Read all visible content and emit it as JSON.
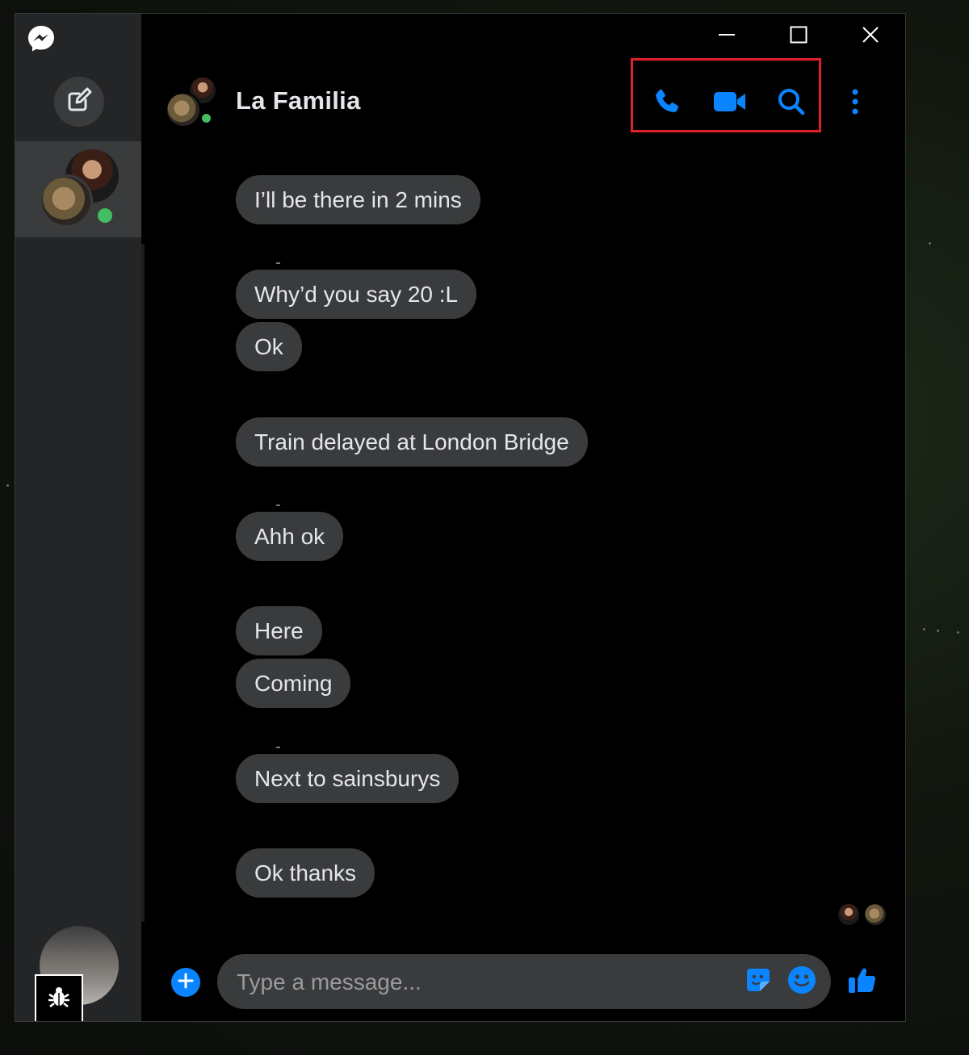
{
  "window": {
    "minimize_icon": "minimize-icon",
    "maximize_icon": "maximize-icon",
    "close_icon": "close-icon"
  },
  "sidebar": {
    "logo_icon": "messenger-logo-icon",
    "compose_icon": "compose-icon",
    "bug_icon": "bug-icon"
  },
  "header": {
    "title": "La Familia",
    "call_icon": "phone-icon",
    "video_icon": "video-camera-icon",
    "search_icon": "search-icon",
    "more_icon": "more-vertical-icon"
  },
  "messages": [
    {
      "text": "I’ll be there in 2 mins"
    },
    {
      "text": "Why’d you say 20 :L"
    },
    {
      "text": "Ok"
    },
    {
      "text": "Train delayed at London Bridge"
    },
    {
      "text": "Ahh ok"
    },
    {
      "text": "Here"
    },
    {
      "text": "Coming"
    },
    {
      "text": "Next to sainsburys"
    },
    {
      "text": "Ok thanks"
    }
  ],
  "composer": {
    "placeholder": "Type a message...",
    "add_icon": "plus-circle-icon",
    "sticker_icon": "sticker-icon",
    "emoji_icon": "emoji-icon",
    "like_icon": "thumbs-up-icon"
  },
  "colors": {
    "accent": "#0a84ff",
    "bubble": "#3a3b3c",
    "online": "#45bd62",
    "highlight": "#e0202a"
  }
}
